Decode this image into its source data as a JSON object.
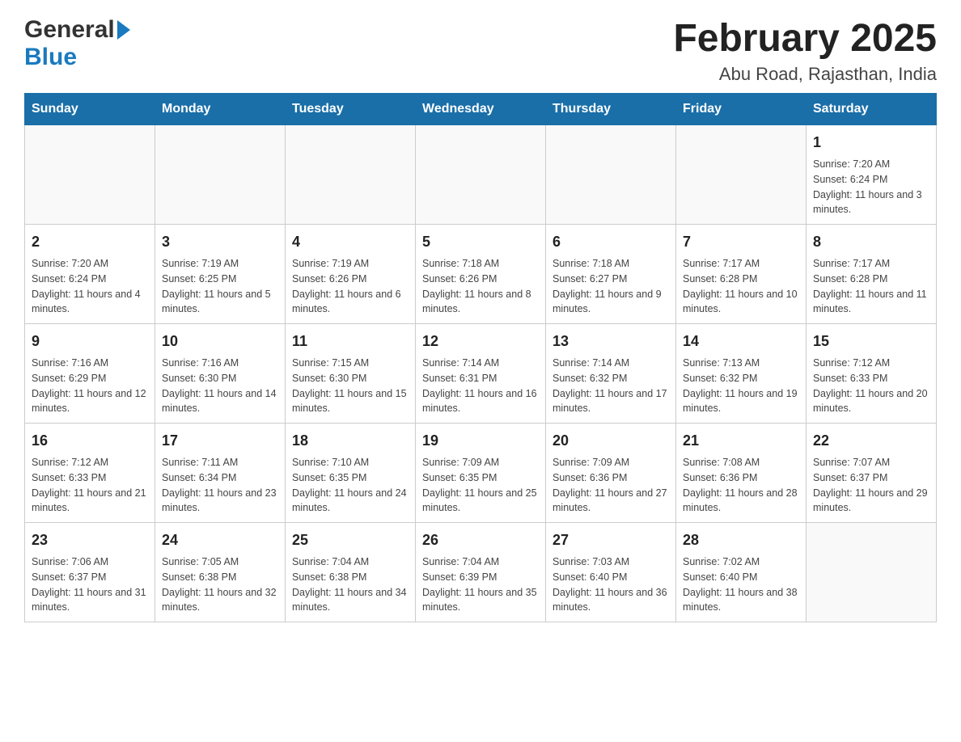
{
  "header": {
    "logo_general": "General",
    "logo_blue": "Blue",
    "title": "February 2025",
    "subtitle": "Abu Road, Rajasthan, India"
  },
  "days_of_week": [
    "Sunday",
    "Monday",
    "Tuesday",
    "Wednesday",
    "Thursday",
    "Friday",
    "Saturday"
  ],
  "weeks": [
    {
      "days": [
        {
          "number": "",
          "info": "",
          "empty": true
        },
        {
          "number": "",
          "info": "",
          "empty": true
        },
        {
          "number": "",
          "info": "",
          "empty": true
        },
        {
          "number": "",
          "info": "",
          "empty": true
        },
        {
          "number": "",
          "info": "",
          "empty": true
        },
        {
          "number": "",
          "info": "",
          "empty": true
        },
        {
          "number": "1",
          "info": "Sunrise: 7:20 AM\nSunset: 6:24 PM\nDaylight: 11 hours and 3 minutes.",
          "empty": false
        }
      ]
    },
    {
      "days": [
        {
          "number": "2",
          "info": "Sunrise: 7:20 AM\nSunset: 6:24 PM\nDaylight: 11 hours and 4 minutes.",
          "empty": false
        },
        {
          "number": "3",
          "info": "Sunrise: 7:19 AM\nSunset: 6:25 PM\nDaylight: 11 hours and 5 minutes.",
          "empty": false
        },
        {
          "number": "4",
          "info": "Sunrise: 7:19 AM\nSunset: 6:26 PM\nDaylight: 11 hours and 6 minutes.",
          "empty": false
        },
        {
          "number": "5",
          "info": "Sunrise: 7:18 AM\nSunset: 6:26 PM\nDaylight: 11 hours and 8 minutes.",
          "empty": false
        },
        {
          "number": "6",
          "info": "Sunrise: 7:18 AM\nSunset: 6:27 PM\nDaylight: 11 hours and 9 minutes.",
          "empty": false
        },
        {
          "number": "7",
          "info": "Sunrise: 7:17 AM\nSunset: 6:28 PM\nDaylight: 11 hours and 10 minutes.",
          "empty": false
        },
        {
          "number": "8",
          "info": "Sunrise: 7:17 AM\nSunset: 6:28 PM\nDaylight: 11 hours and 11 minutes.",
          "empty": false
        }
      ]
    },
    {
      "days": [
        {
          "number": "9",
          "info": "Sunrise: 7:16 AM\nSunset: 6:29 PM\nDaylight: 11 hours and 12 minutes.",
          "empty": false
        },
        {
          "number": "10",
          "info": "Sunrise: 7:16 AM\nSunset: 6:30 PM\nDaylight: 11 hours and 14 minutes.",
          "empty": false
        },
        {
          "number": "11",
          "info": "Sunrise: 7:15 AM\nSunset: 6:30 PM\nDaylight: 11 hours and 15 minutes.",
          "empty": false
        },
        {
          "number": "12",
          "info": "Sunrise: 7:14 AM\nSunset: 6:31 PM\nDaylight: 11 hours and 16 minutes.",
          "empty": false
        },
        {
          "number": "13",
          "info": "Sunrise: 7:14 AM\nSunset: 6:32 PM\nDaylight: 11 hours and 17 minutes.",
          "empty": false
        },
        {
          "number": "14",
          "info": "Sunrise: 7:13 AM\nSunset: 6:32 PM\nDaylight: 11 hours and 19 minutes.",
          "empty": false
        },
        {
          "number": "15",
          "info": "Sunrise: 7:12 AM\nSunset: 6:33 PM\nDaylight: 11 hours and 20 minutes.",
          "empty": false
        }
      ]
    },
    {
      "days": [
        {
          "number": "16",
          "info": "Sunrise: 7:12 AM\nSunset: 6:33 PM\nDaylight: 11 hours and 21 minutes.",
          "empty": false
        },
        {
          "number": "17",
          "info": "Sunrise: 7:11 AM\nSunset: 6:34 PM\nDaylight: 11 hours and 23 minutes.",
          "empty": false
        },
        {
          "number": "18",
          "info": "Sunrise: 7:10 AM\nSunset: 6:35 PM\nDaylight: 11 hours and 24 minutes.",
          "empty": false
        },
        {
          "number": "19",
          "info": "Sunrise: 7:09 AM\nSunset: 6:35 PM\nDaylight: 11 hours and 25 minutes.",
          "empty": false
        },
        {
          "number": "20",
          "info": "Sunrise: 7:09 AM\nSunset: 6:36 PM\nDaylight: 11 hours and 27 minutes.",
          "empty": false
        },
        {
          "number": "21",
          "info": "Sunrise: 7:08 AM\nSunset: 6:36 PM\nDaylight: 11 hours and 28 minutes.",
          "empty": false
        },
        {
          "number": "22",
          "info": "Sunrise: 7:07 AM\nSunset: 6:37 PM\nDaylight: 11 hours and 29 minutes.",
          "empty": false
        }
      ]
    },
    {
      "days": [
        {
          "number": "23",
          "info": "Sunrise: 7:06 AM\nSunset: 6:37 PM\nDaylight: 11 hours and 31 minutes.",
          "empty": false
        },
        {
          "number": "24",
          "info": "Sunrise: 7:05 AM\nSunset: 6:38 PM\nDaylight: 11 hours and 32 minutes.",
          "empty": false
        },
        {
          "number": "25",
          "info": "Sunrise: 7:04 AM\nSunset: 6:38 PM\nDaylight: 11 hours and 34 minutes.",
          "empty": false
        },
        {
          "number": "26",
          "info": "Sunrise: 7:04 AM\nSunset: 6:39 PM\nDaylight: 11 hours and 35 minutes.",
          "empty": false
        },
        {
          "number": "27",
          "info": "Sunrise: 7:03 AM\nSunset: 6:40 PM\nDaylight: 11 hours and 36 minutes.",
          "empty": false
        },
        {
          "number": "28",
          "info": "Sunrise: 7:02 AM\nSunset: 6:40 PM\nDaylight: 11 hours and 38 minutes.",
          "empty": false
        },
        {
          "number": "",
          "info": "",
          "empty": true
        }
      ]
    }
  ]
}
